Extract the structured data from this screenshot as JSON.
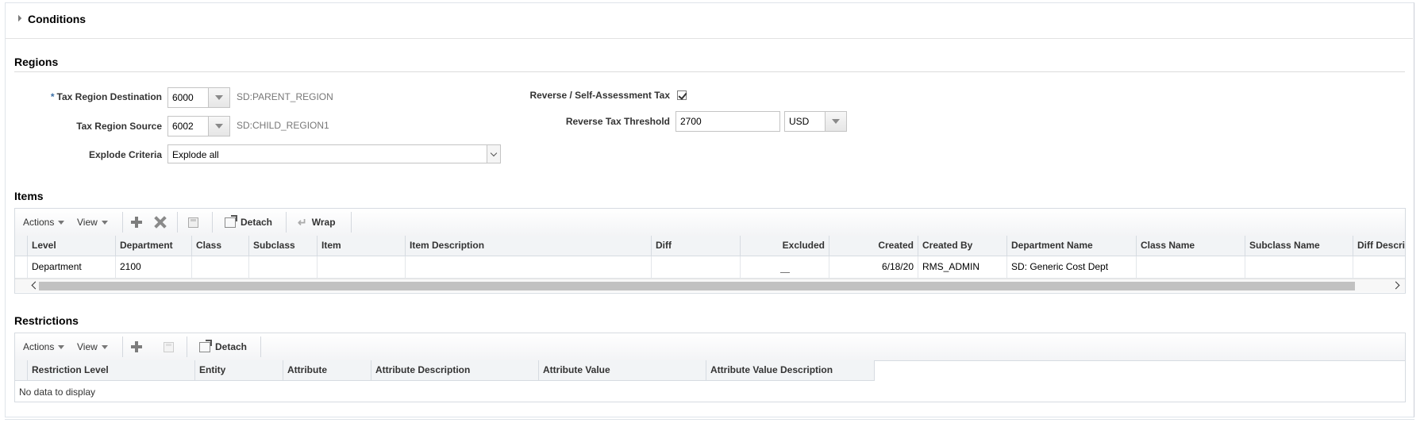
{
  "conditions": {
    "title": "Conditions"
  },
  "regions": {
    "title": "Regions",
    "tax_region_destination": {
      "label": "Tax Region Destination",
      "required": "*",
      "value": "6000",
      "description": "SD:PARENT_REGION"
    },
    "tax_region_source": {
      "label": "Tax Region Source",
      "value": "6002",
      "description": "SD:CHILD_REGION1"
    },
    "explode_criteria": {
      "label": "Explode Criteria",
      "value": "Explode all"
    },
    "reverse_self_assessment": {
      "label": "Reverse / Self-Assessment Tax",
      "checked": true
    },
    "reverse_tax_threshold": {
      "label": "Reverse Tax Threshold",
      "value": "2700",
      "currency": "USD"
    }
  },
  "items": {
    "title": "Items",
    "toolbar": {
      "actions": "Actions",
      "view": "View",
      "detach": "Detach",
      "wrap": "Wrap"
    },
    "columns": [
      "Level",
      "Department",
      "Class",
      "Subclass",
      "Item",
      "Item Description",
      "Diff",
      "Excluded",
      "Created",
      "Created By",
      "Department Name",
      "Class Name",
      "Subclass Name",
      "Diff Descrip"
    ],
    "rows": [
      {
        "level": "Department",
        "department": "2100",
        "class": "",
        "subclass": "",
        "item": "",
        "item_description": "",
        "diff": "",
        "excluded": "",
        "created": "6/18/20",
        "created_by": "RMS_ADMIN",
        "department_name": "SD: Generic Cost Dept",
        "class_name": "",
        "subclass_name": "",
        "diff_description": ""
      }
    ]
  },
  "restrictions": {
    "title": "Restrictions",
    "toolbar": {
      "actions": "Actions",
      "view": "View",
      "detach": "Detach"
    },
    "columns": [
      "Restriction Level",
      "Entity",
      "Attribute",
      "Attribute Description",
      "Attribute Value",
      "Attribute Value Description"
    ],
    "empty_text": "No data to display"
  },
  "icons": [
    "triangle-down-icon",
    "chevron-down-icon",
    "checkbox-icon",
    "add-icon",
    "delete-icon",
    "save-icon",
    "detach-icon",
    "wrap-icon",
    "scroll-left-icon",
    "scroll-right-icon"
  ]
}
